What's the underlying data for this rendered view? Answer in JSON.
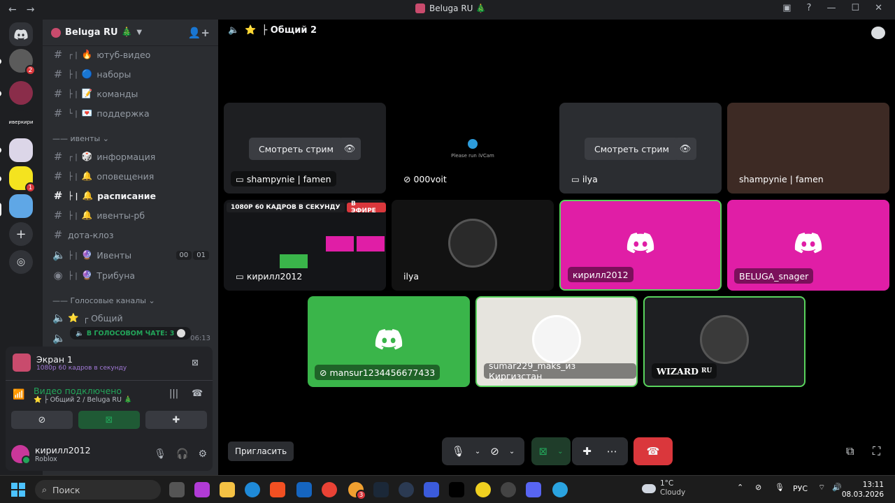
{
  "window": {
    "title": "Beluga RU 🎄",
    "nav_back": "←",
    "nav_forward": "→",
    "controls": [
      "▣",
      "?",
      "—",
      "☐",
      "✕"
    ]
  },
  "rail": {
    "home_icon": "discord-icon",
    "servers": [
      {
        "name": "server-1",
        "badge": "2",
        "color": "#5b5b5b"
      },
      {
        "name": "server-2",
        "badge": "",
        "color": "#8a2d4a"
      },
      {
        "name": "server-3",
        "label": "иверкири",
        "badge": "",
        "color": "#1e1f22"
      },
      {
        "name": "server-4",
        "badge": "",
        "color": "#dcd6e8"
      },
      {
        "name": "server-5",
        "badge": "1",
        "color": "#f4e31f"
      },
      {
        "name": "server-6",
        "badge": "",
        "color": "#5fa7e6"
      }
    ]
  },
  "sidebar": {
    "server_name": "Beluga RU 🎄",
    "text_channels": [
      {
        "tree": "┌ |",
        "emoji": "🔥",
        "name": "ютуб-видео"
      },
      {
        "tree": "├ |",
        "emoji": "🔵",
        "name": "наборы"
      },
      {
        "tree": "├ |",
        "emoji": "📝",
        "name": "команды"
      },
      {
        "tree": "└ |",
        "emoji": "💌",
        "name": "поддержка"
      }
    ],
    "events_category": "—— ивенты",
    "events_channels": [
      {
        "tree": "┌ |",
        "emoji": "🎲",
        "name": "информация",
        "active": false
      },
      {
        "tree": "├ |",
        "emoji": "🔔",
        "name": "оповещения",
        "active": false
      },
      {
        "tree": "├ |",
        "emoji": "🔔",
        "name": "расписание",
        "active": true
      },
      {
        "tree": "├ |",
        "emoji": "🔔",
        "name": "ивенты-рб",
        "active": false
      }
    ],
    "dota_channel": "дота-клоз",
    "voice_event": {
      "tree": "├ |",
      "emoji": "🔮",
      "name": "Ивенты",
      "count_a": "00",
      "count_b": "01"
    },
    "tribune": {
      "tree": "├ |",
      "emoji": "🔮",
      "name": "Трибуна"
    },
    "voice_category": "—— Голосовые каналы",
    "voice_general": {
      "emoji": "⭐",
      "name": "┌ Общий"
    },
    "voice_tip": "В ГОЛОСОВОМ ЧАТЕ: 3",
    "voice_timer": "06:13"
  },
  "voice_panel": {
    "screen_title": "Экран 1",
    "screen_sub": "1080p 60 кадров в секунду",
    "connected": "Видео подключено",
    "connected_sub": "⭐ ├ Общий 2 / Beluga RU 🎄"
  },
  "user": {
    "name": "кирилл2012",
    "status": "Roblox"
  },
  "stage": {
    "channel": "├ Общий 2",
    "watch_label": "Смотреть стрим",
    "tiles": [
      {
        "name": "shampynie | famen",
        "type": "stream"
      },
      {
        "name": "000voit",
        "type": "ivcam",
        "ivcam_text": "Please run iVCam"
      },
      {
        "name": "ilya",
        "type": "stream"
      },
      {
        "name": "shampynie | famen",
        "type": "camera"
      },
      {
        "name": "кирилл2012",
        "type": "screen",
        "live_badge": "1080P 60 КАДРОВ В СЕКУНДУ",
        "live_red": "В ЭФИРЕ"
      },
      {
        "name": "ilya",
        "type": "avatar"
      },
      {
        "name": "кирилл2012",
        "type": "pink"
      },
      {
        "name": "BELUGA_snager",
        "type": "pink"
      },
      {
        "name": "mansur1234456677433",
        "type": "green"
      },
      {
        "name": "sumar229_maks_из Киргизстан",
        "type": "avatar-light"
      },
      {
        "name": "WIZARD",
        "suffix": "RU",
        "type": "avatar-dark"
      }
    ],
    "invite": "Пригласить"
  },
  "taskbar": {
    "search_placeholder": "Поиск",
    "weather_temp": "1°C",
    "weather_desc": "Cloudy",
    "lang": "РУС",
    "time": "13:11",
    "date": "08.03.2026",
    "notif_badge": "3"
  }
}
